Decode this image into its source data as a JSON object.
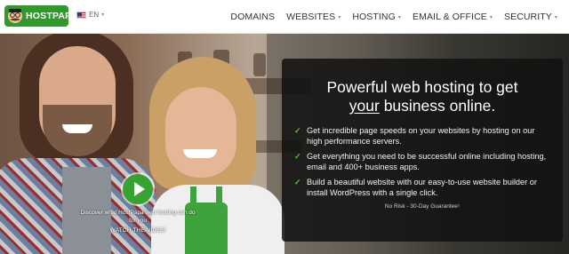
{
  "header": {
    "logo_text": "HOSTPAPA",
    "language": "EN",
    "nav": [
      {
        "label": "DOMAINS",
        "dropdown": false
      },
      {
        "label": "WEBSITES",
        "dropdown": true
      },
      {
        "label": "HOSTING",
        "dropdown": true
      },
      {
        "label": "EMAIL & OFFICE",
        "dropdown": true
      },
      {
        "label": "SECURITY",
        "dropdown": true
      }
    ]
  },
  "hero": {
    "headline_pre": "Powerful web hosting to get",
    "headline_em": "your",
    "headline_post": " business online.",
    "features": [
      "Get incredible page speeds on your websites by hosting on our high performance servers.",
      "Get everything you need to be successful online including hosting, email and 400+ business apps.",
      "Build a beautiful website with our easy-to-use website builder or install WordPress with a single click."
    ],
    "guarantee": "No Risk - 30-Day Guarantee¹",
    "video_caption": "Discover what HostPapa web hosting can do for you",
    "video_cta": "WATCH THE VIDEO"
  },
  "icons": {
    "check": "check-icon",
    "play": "play-icon",
    "caret": "chevron-down-icon",
    "flag": "us-flag-icon"
  },
  "colors": {
    "brand_green": "#2f9a2a",
    "check_green": "#5fbf3c",
    "panel_bg": "#121212"
  }
}
